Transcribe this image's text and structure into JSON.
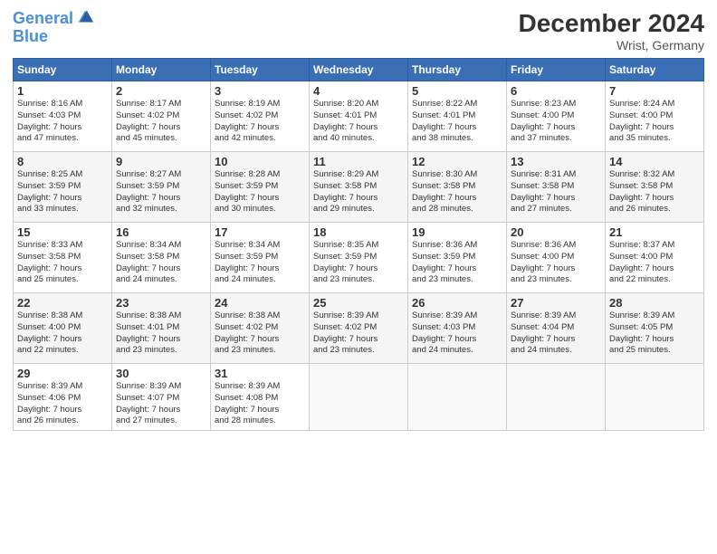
{
  "header": {
    "logo_line1": "General",
    "logo_line2": "Blue",
    "title": "December 2024",
    "location": "Wrist, Germany"
  },
  "weekdays": [
    "Sunday",
    "Monday",
    "Tuesday",
    "Wednesday",
    "Thursday",
    "Friday",
    "Saturday"
  ],
  "weeks": [
    [
      {
        "day": "1",
        "info": "Sunrise: 8:16 AM\nSunset: 4:03 PM\nDaylight: 7 hours\nand 47 minutes."
      },
      {
        "day": "2",
        "info": "Sunrise: 8:17 AM\nSunset: 4:02 PM\nDaylight: 7 hours\nand 45 minutes."
      },
      {
        "day": "3",
        "info": "Sunrise: 8:19 AM\nSunset: 4:02 PM\nDaylight: 7 hours\nand 42 minutes."
      },
      {
        "day": "4",
        "info": "Sunrise: 8:20 AM\nSunset: 4:01 PM\nDaylight: 7 hours\nand 40 minutes."
      },
      {
        "day": "5",
        "info": "Sunrise: 8:22 AM\nSunset: 4:01 PM\nDaylight: 7 hours\nand 38 minutes."
      },
      {
        "day": "6",
        "info": "Sunrise: 8:23 AM\nSunset: 4:00 PM\nDaylight: 7 hours\nand 37 minutes."
      },
      {
        "day": "7",
        "info": "Sunrise: 8:24 AM\nSunset: 4:00 PM\nDaylight: 7 hours\nand 35 minutes."
      }
    ],
    [
      {
        "day": "8",
        "info": "Sunrise: 8:25 AM\nSunset: 3:59 PM\nDaylight: 7 hours\nand 33 minutes."
      },
      {
        "day": "9",
        "info": "Sunrise: 8:27 AM\nSunset: 3:59 PM\nDaylight: 7 hours\nand 32 minutes."
      },
      {
        "day": "10",
        "info": "Sunrise: 8:28 AM\nSunset: 3:59 PM\nDaylight: 7 hours\nand 30 minutes."
      },
      {
        "day": "11",
        "info": "Sunrise: 8:29 AM\nSunset: 3:58 PM\nDaylight: 7 hours\nand 29 minutes."
      },
      {
        "day": "12",
        "info": "Sunrise: 8:30 AM\nSunset: 3:58 PM\nDaylight: 7 hours\nand 28 minutes."
      },
      {
        "day": "13",
        "info": "Sunrise: 8:31 AM\nSunset: 3:58 PM\nDaylight: 7 hours\nand 27 minutes."
      },
      {
        "day": "14",
        "info": "Sunrise: 8:32 AM\nSunset: 3:58 PM\nDaylight: 7 hours\nand 26 minutes."
      }
    ],
    [
      {
        "day": "15",
        "info": "Sunrise: 8:33 AM\nSunset: 3:58 PM\nDaylight: 7 hours\nand 25 minutes."
      },
      {
        "day": "16",
        "info": "Sunrise: 8:34 AM\nSunset: 3:58 PM\nDaylight: 7 hours\nand 24 minutes."
      },
      {
        "day": "17",
        "info": "Sunrise: 8:34 AM\nSunset: 3:59 PM\nDaylight: 7 hours\nand 24 minutes."
      },
      {
        "day": "18",
        "info": "Sunrise: 8:35 AM\nSunset: 3:59 PM\nDaylight: 7 hours\nand 23 minutes."
      },
      {
        "day": "19",
        "info": "Sunrise: 8:36 AM\nSunset: 3:59 PM\nDaylight: 7 hours\nand 23 minutes."
      },
      {
        "day": "20",
        "info": "Sunrise: 8:36 AM\nSunset: 4:00 PM\nDaylight: 7 hours\nand 23 minutes."
      },
      {
        "day": "21",
        "info": "Sunrise: 8:37 AM\nSunset: 4:00 PM\nDaylight: 7 hours\nand 22 minutes."
      }
    ],
    [
      {
        "day": "22",
        "info": "Sunrise: 8:38 AM\nSunset: 4:00 PM\nDaylight: 7 hours\nand 22 minutes."
      },
      {
        "day": "23",
        "info": "Sunrise: 8:38 AM\nSunset: 4:01 PM\nDaylight: 7 hours\nand 23 minutes."
      },
      {
        "day": "24",
        "info": "Sunrise: 8:38 AM\nSunset: 4:02 PM\nDaylight: 7 hours\nand 23 minutes."
      },
      {
        "day": "25",
        "info": "Sunrise: 8:39 AM\nSunset: 4:02 PM\nDaylight: 7 hours\nand 23 minutes."
      },
      {
        "day": "26",
        "info": "Sunrise: 8:39 AM\nSunset: 4:03 PM\nDaylight: 7 hours\nand 24 minutes."
      },
      {
        "day": "27",
        "info": "Sunrise: 8:39 AM\nSunset: 4:04 PM\nDaylight: 7 hours\nand 24 minutes."
      },
      {
        "day": "28",
        "info": "Sunrise: 8:39 AM\nSunset: 4:05 PM\nDaylight: 7 hours\nand 25 minutes."
      }
    ],
    [
      {
        "day": "29",
        "info": "Sunrise: 8:39 AM\nSunset: 4:06 PM\nDaylight: 7 hours\nand 26 minutes."
      },
      {
        "day": "30",
        "info": "Sunrise: 8:39 AM\nSunset: 4:07 PM\nDaylight: 7 hours\nand 27 minutes."
      },
      {
        "day": "31",
        "info": "Sunrise: 8:39 AM\nSunset: 4:08 PM\nDaylight: 7 hours\nand 28 minutes."
      },
      {
        "day": "",
        "info": ""
      },
      {
        "day": "",
        "info": ""
      },
      {
        "day": "",
        "info": ""
      },
      {
        "day": "",
        "info": ""
      }
    ]
  ]
}
